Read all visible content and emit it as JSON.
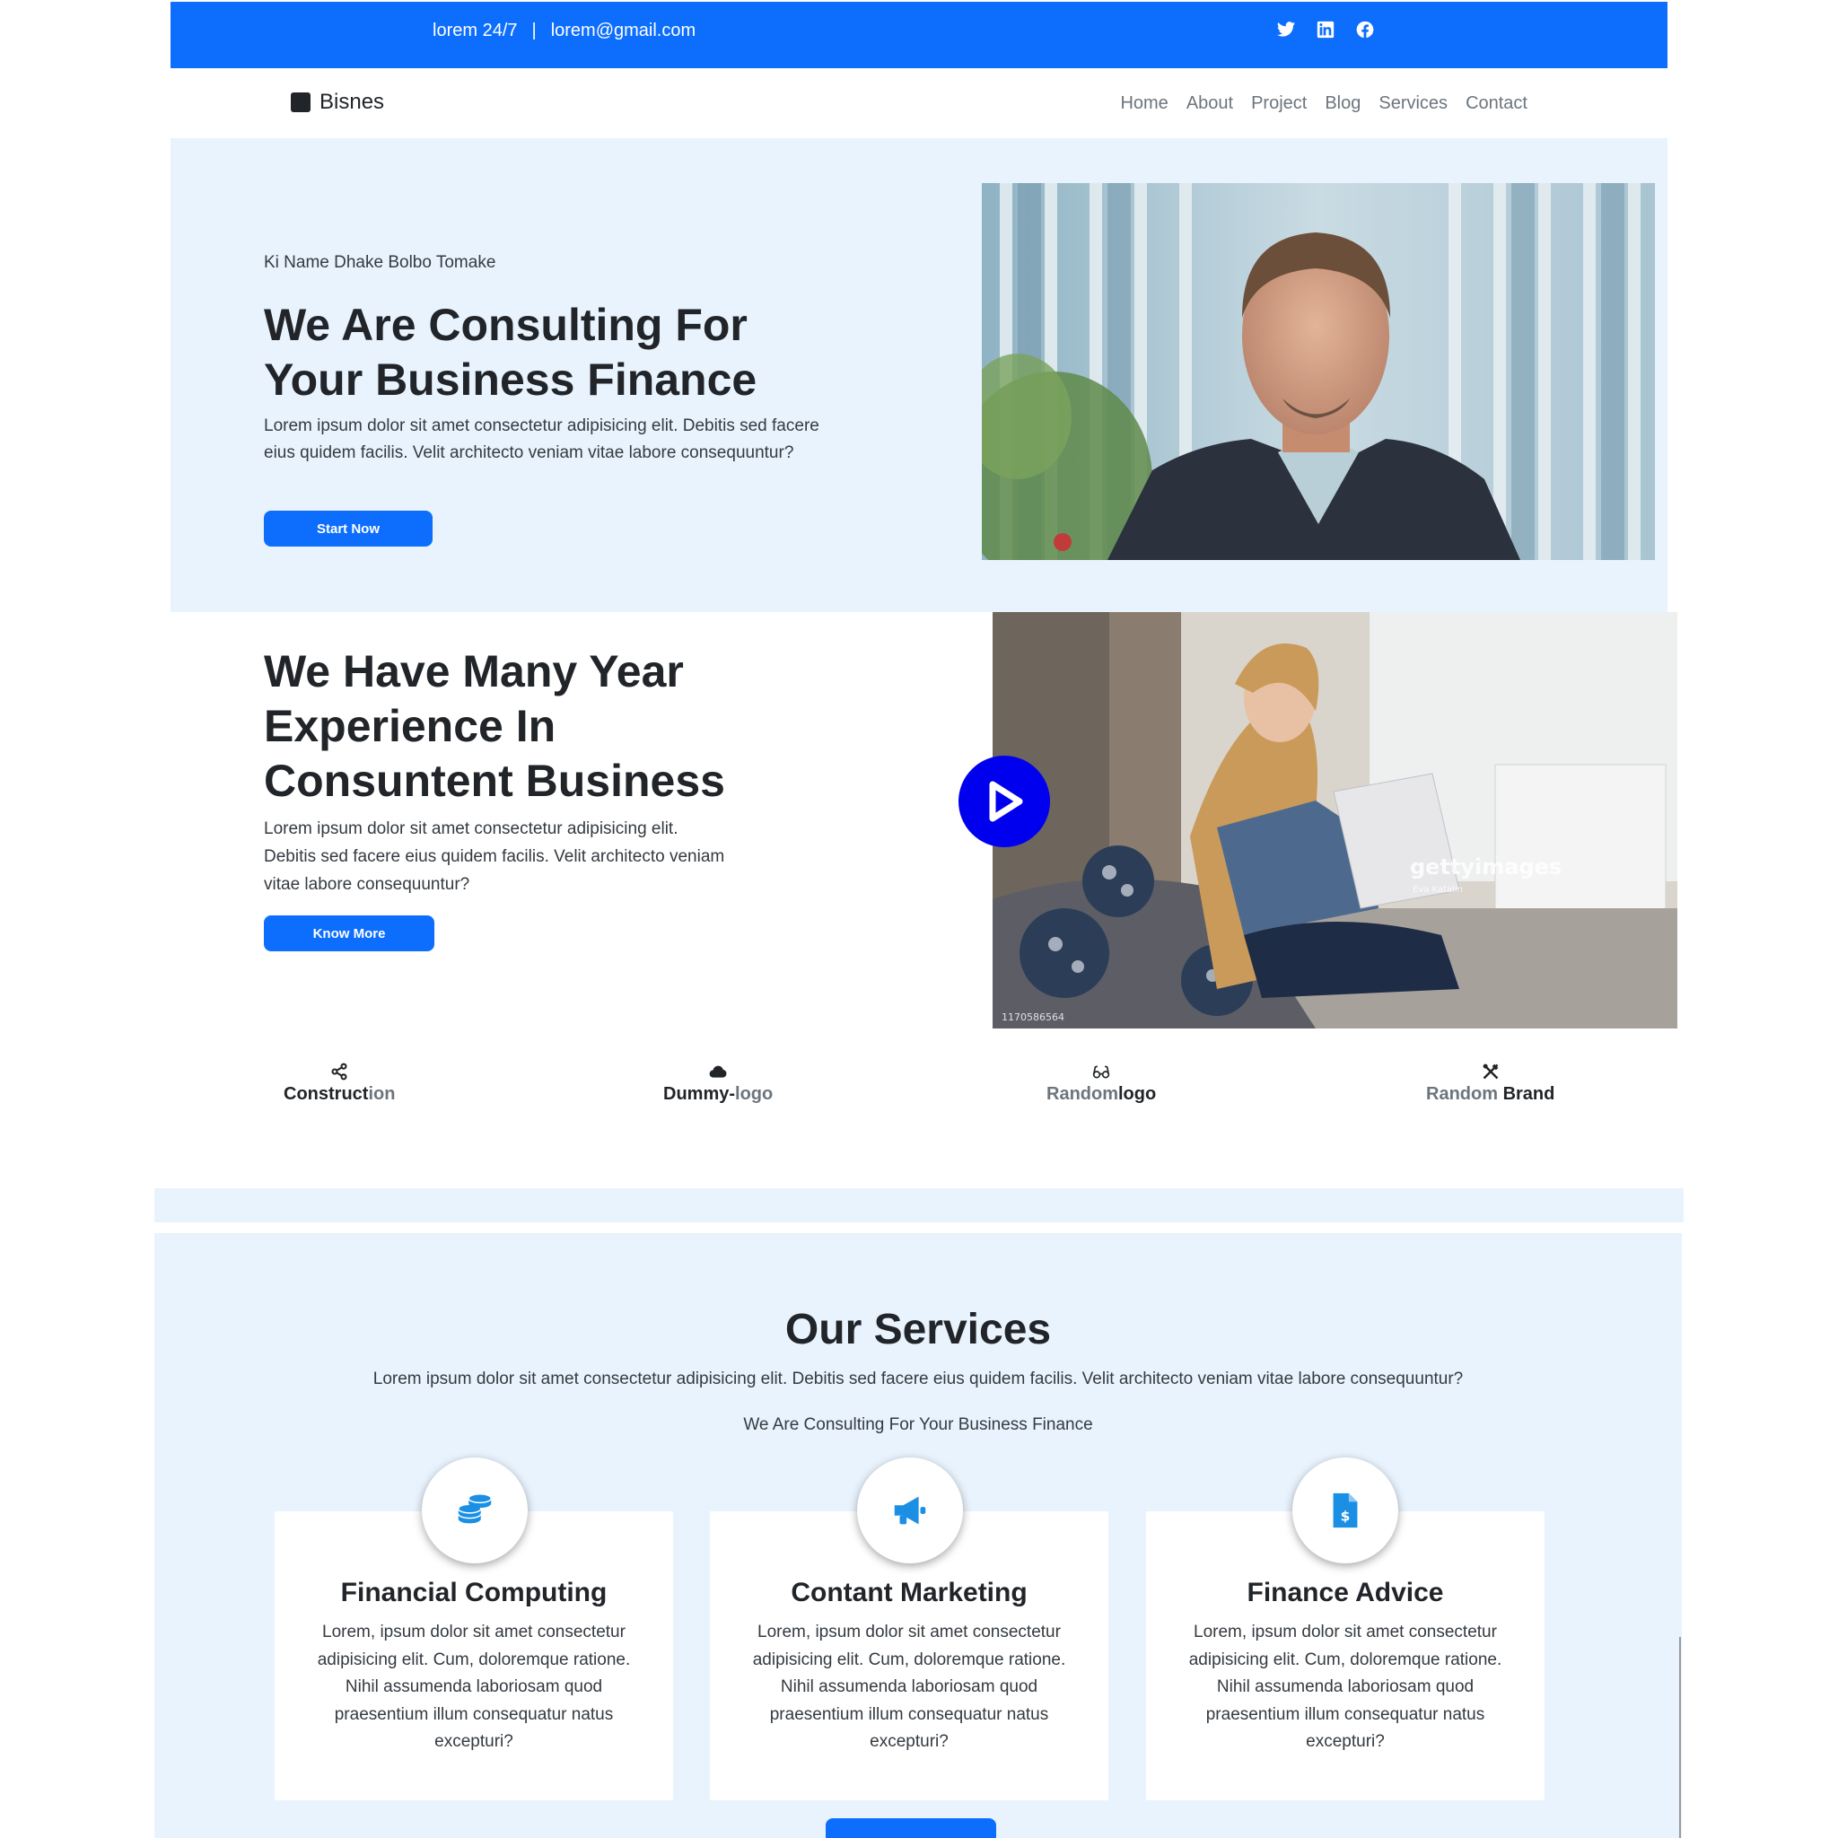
{
  "topbar": {
    "hours": "lorem 24/7",
    "separator": "|",
    "email": "lorem@gmail.com",
    "social_icons": [
      "twitter-icon",
      "linkedin-icon",
      "facebook-icon"
    ]
  },
  "navbar": {
    "brand": "Bisnes",
    "links": [
      "Home",
      "About",
      "Project",
      "Blog",
      "Services",
      "Contact"
    ]
  },
  "hero": {
    "kicker": "Ki Name Dhake Bolbo Tomake",
    "title": "We Are Consulting For Your Business Finance",
    "text": "Lorem ipsum dolor sit amet consectetur adipisicing elit. Debitis sed facere eius quidem facilis. Velit architecto veniam vitae labore consequuntur?",
    "button": "Start Now"
  },
  "experience": {
    "title": "We Have Many Year Experience In Consuntent Business",
    "text": "Lorem ipsum dolor sit amet consectetur adipisicing elit. Debitis sed facere eius quidem facilis. Velit architecto veniam vitae labore consequuntur?",
    "button": "Know More",
    "watermark": "gettyimages",
    "watermark_credit": "Eva Katalin",
    "image_id": "1170586564"
  },
  "logos": [
    {
      "bold": "Construct",
      "muted": "ion",
      "icon": "share-nodes-icon"
    },
    {
      "bold": "Dummy-",
      "muted": "logo",
      "icon": "cloud-icon"
    },
    {
      "muted": "Random",
      "bold": "logo",
      "icon": "glasses-icon"
    },
    {
      "muted": "Random ",
      "bold": "Brand",
      "icon": "tools-icon"
    }
  ],
  "services": {
    "title": "Our Services",
    "text": "Lorem ipsum dolor sit amet consectetur adipisicing elit. Debitis sed facere eius quidem facilis. Velit architecto veniam vitae labore consequuntur?",
    "subtitle": "We Are Consulting For Your Business Finance",
    "cards": [
      {
        "title": "Financial Computing",
        "text": "Lorem, ipsum dolor sit amet consectetur adipisicing elit. Cum, doloremque ratione. Nihil assumenda laboriosam quod praesentium illum consequatur natus excepturi?",
        "icon": "coins-icon"
      },
      {
        "title": "Contant Marketing",
        "text": "Lorem, ipsum dolor sit amet consectetur adipisicing elit. Cum, doloremque ratione. Nihil assumenda laboriosam quod praesentium illum consequatur natus excepturi?",
        "icon": "megaphone-icon"
      },
      {
        "title": "Finance Advice",
        "text": "Lorem, ipsum dolor sit amet consectetur adipisicing elit. Cum, doloremque ratione. Nihil assumenda laboriosam quod praesentium illum consequatur natus excepturi?",
        "icon": "invoice-dollar-icon"
      }
    ]
  },
  "colors": {
    "primary": "#0d6efd",
    "hero_bg": "#e9f3fd",
    "play_button": "#0000ee",
    "icon_blue": "#1a8fe3"
  }
}
